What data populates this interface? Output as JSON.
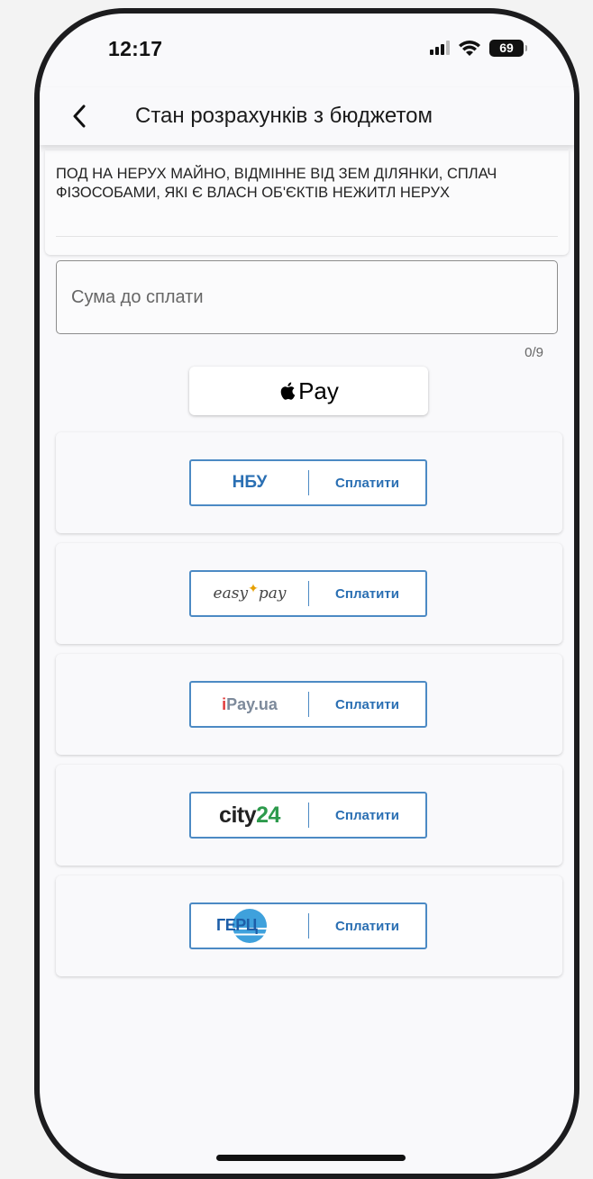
{
  "status_bar": {
    "time": "12:17",
    "battery": "69"
  },
  "nav": {
    "title": "Стан розрахунків з бюджетом"
  },
  "payment": {
    "description": "ПОД НА НЕРУХ МАЙНО, ВІДМІННЕ ВІД ЗЕМ ДІЛЯНКИ, СПЛАЧ ФІЗОСОБАМИ, ЯКІ Є ВЛАСН ОБ'ЄКТІВ НЕЖИТЛ НЕРУХ",
    "amount_placeholder": "Сума до сплати",
    "amount_value": "",
    "char_counter": "0/9"
  },
  "apple_pay": {
    "label": "Pay"
  },
  "providers": [
    {
      "logo_text": "НБУ",
      "action": "Сплатити"
    },
    {
      "logo_text": "easypay",
      "action": "Сплатити"
    },
    {
      "logo_text": "iPay.ua",
      "action": "Сплатити"
    },
    {
      "logo_text": "city24",
      "action": "Сплатити"
    },
    {
      "logo_text": "ГЕРЦ",
      "action": "Сплатити"
    }
  ],
  "logos": {
    "easypay": {
      "left": "easy",
      "right": "pay"
    },
    "ipay": {
      "i": "i",
      "rest": "Pay.ua"
    },
    "city24": {
      "word": "city",
      "num": "24"
    }
  },
  "colors": {
    "accent": "#2a6fb3",
    "button_border": "#4c8ac4",
    "city24_green": "#2d9a4c",
    "ipay_red": "#e23b3b",
    "gerc_blue": "#3fa1dc"
  }
}
